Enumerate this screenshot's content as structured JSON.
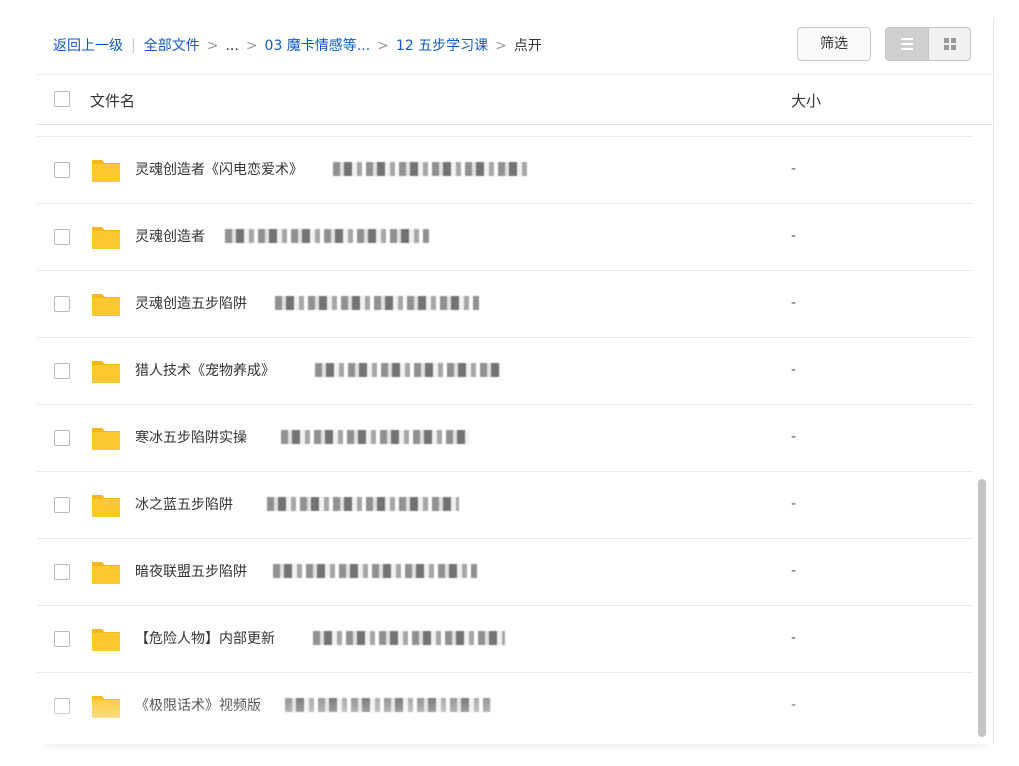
{
  "breadcrumb": {
    "back": "返回上一级",
    "all_files": "全部文件",
    "ellipsis": "...",
    "level1": "03 魔卡情感等...",
    "level2": "12 五步学习课",
    "current": "点开",
    "separator": ">"
  },
  "toolbar": {
    "filter_label": "筛选",
    "view_mode": "list"
  },
  "table": {
    "header_name": "文件名",
    "header_size": "大小"
  },
  "rows": [
    {
      "name": "灵魂创造者《闪电恋爱术》",
      "size": "-"
    },
    {
      "name": "灵魂创造者",
      "size": "-"
    },
    {
      "name": "灵魂创造五步陷阱",
      "size": "-"
    },
    {
      "name": "猎人技术《宠物养成》",
      "size": "-"
    },
    {
      "name": "寒冰五步陷阱实操",
      "size": "-"
    },
    {
      "name": "冰之蓝五步陷阱",
      "size": "-"
    },
    {
      "name": "暗夜联盟五步陷阱",
      "size": "-"
    },
    {
      "name": "【危险人物】内部更新",
      "size": "-"
    },
    {
      "name": "《极限话术》视频版",
      "size": "-"
    }
  ],
  "colors": {
    "link": "#0d5bc6",
    "folder": "#fcc82f",
    "folder_tab": "#f5b81c"
  },
  "icons": {
    "folder": "folder-icon",
    "list_view": "list-view-icon",
    "grid_view": "grid-view-icon"
  }
}
